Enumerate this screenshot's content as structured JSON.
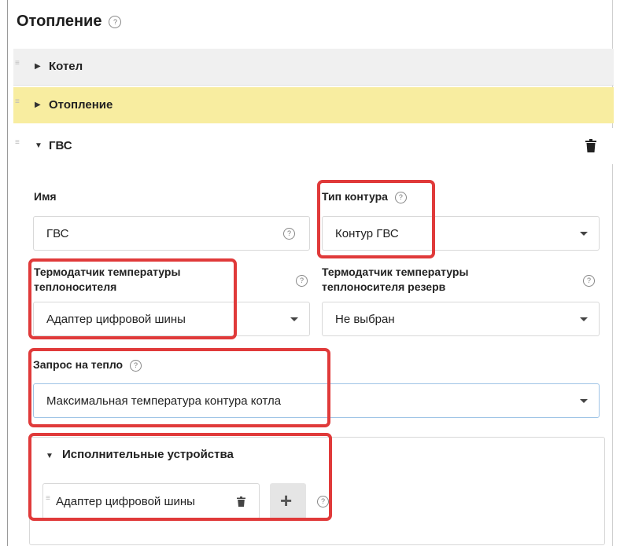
{
  "page": {
    "title": "Отопление"
  },
  "sections": [
    {
      "label": "Котел",
      "expanded": false
    },
    {
      "label": "Отопление",
      "expanded": false
    },
    {
      "label": "ГВС",
      "expanded": true
    }
  ],
  "form": {
    "name": {
      "label": "Имя",
      "value": "ГВС"
    },
    "circuit_type": {
      "label": "Тип контура",
      "value": "Контур ГВС"
    },
    "sensor": {
      "label_line1": "Термодатчик температуры",
      "label_line2": "теплоносителя",
      "value": "Адаптер цифровой шины"
    },
    "sensor_reserve": {
      "label_line1": "Термодатчик температуры",
      "label_line2": "теплоносителя резерв",
      "value": "Не выбран"
    },
    "heat_request": {
      "label": "Запрос на тепло",
      "value": "Максимальная температура контура котла"
    },
    "devices": {
      "title": "Исполнительные устройства",
      "items": [
        {
          "label": "Адаптер цифровой шины"
        }
      ]
    }
  },
  "colors": {
    "highlight": "#e03a3a",
    "selected_row": "#f8eda0"
  }
}
